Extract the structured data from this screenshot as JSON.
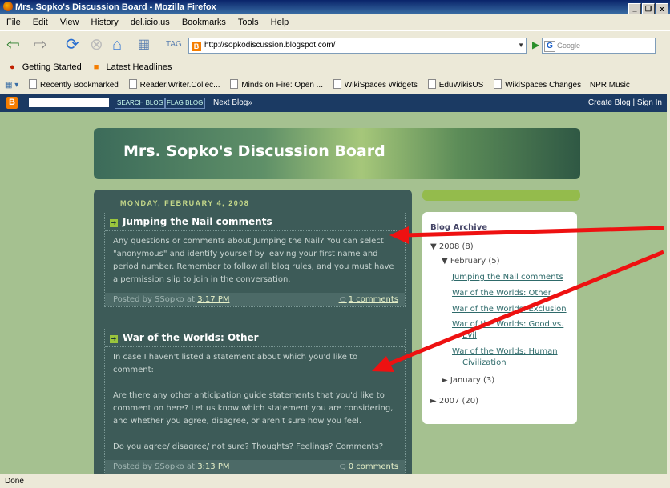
{
  "window": {
    "title": "Mrs. Sopko's Discussion Board - Mozilla Firefox",
    "buttons": [
      "_",
      "❐",
      "x"
    ]
  },
  "menu": [
    "File",
    "Edit",
    "View",
    "History",
    "del.icio.us",
    "Bookmarks",
    "Tools",
    "Help"
  ],
  "nav": {
    "url": "http://sopkodiscussion.blogspot.com/",
    "search_placeholder": "Google"
  },
  "bookmarks": {
    "row1": [
      "Getting Started",
      "Latest Headlines"
    ],
    "row2": [
      "Recently Bookmarked",
      "Reader.Writer.Collec...",
      "Minds on Fire: Open ...",
      "WikiSpaces Widgets",
      "EduWikisUS",
      "WikiSpaces Changes",
      "NPR Music"
    ]
  },
  "blognav": {
    "search_blog": "SEARCH BLOG",
    "flag_blog": "FLAG BLOG",
    "next_blog": "Next Blog»",
    "create_sign": "Create Blog | Sign In"
  },
  "blog": {
    "title": "Mrs. Sopko's Discussion Board",
    "date": "MONDAY, FEBRUARY 4, 2008",
    "posts": [
      {
        "title": "Jumping the Nail comments",
        "body": [
          "Any questions or comments about Jumping the Nail? You can select",
          "\"anonymous\" and identify yourself by leaving your first name and",
          "period number. Remember to follow all blog rules, and you must have",
          "a permission slip to join in the conversation."
        ],
        "posted_by": "Posted by SSopko at",
        "time": "3:17 PM",
        "comments": "1 comments"
      },
      {
        "title": "War of the Worlds: Other",
        "body": [
          "In case I haven't listed a statement about which you'd like to",
          "comment:",
          "",
          "Are there any other anticipation guide statements that you'd like to",
          "comment on here? Let us know which statement you are considering,",
          "and whether you agree, disagree, or aren't sure how you feel.",
          "",
          "Do you agree/ disagree/ not sure? Thoughts? Feelings? Comments?"
        ],
        "posted_by": "Posted by SSopko at",
        "time": "3:13 PM",
        "comments": "0 comments"
      }
    ]
  },
  "archive": {
    "heading": "Blog Archive",
    "y2008": "▼ 2008 (8)",
    "feb": "▼ February (5)",
    "links": [
      "Jumping the Nail comments",
      "War of the Worlds: Other",
      "War of the Worlds: Exclusion",
      "War of the Worlds: Good vs.",
      "Evil",
      "War of the Worlds: Human",
      "Civilization"
    ],
    "jan": "► January (3)",
    "y2007": "► 2007 (20)"
  },
  "status": "Done"
}
